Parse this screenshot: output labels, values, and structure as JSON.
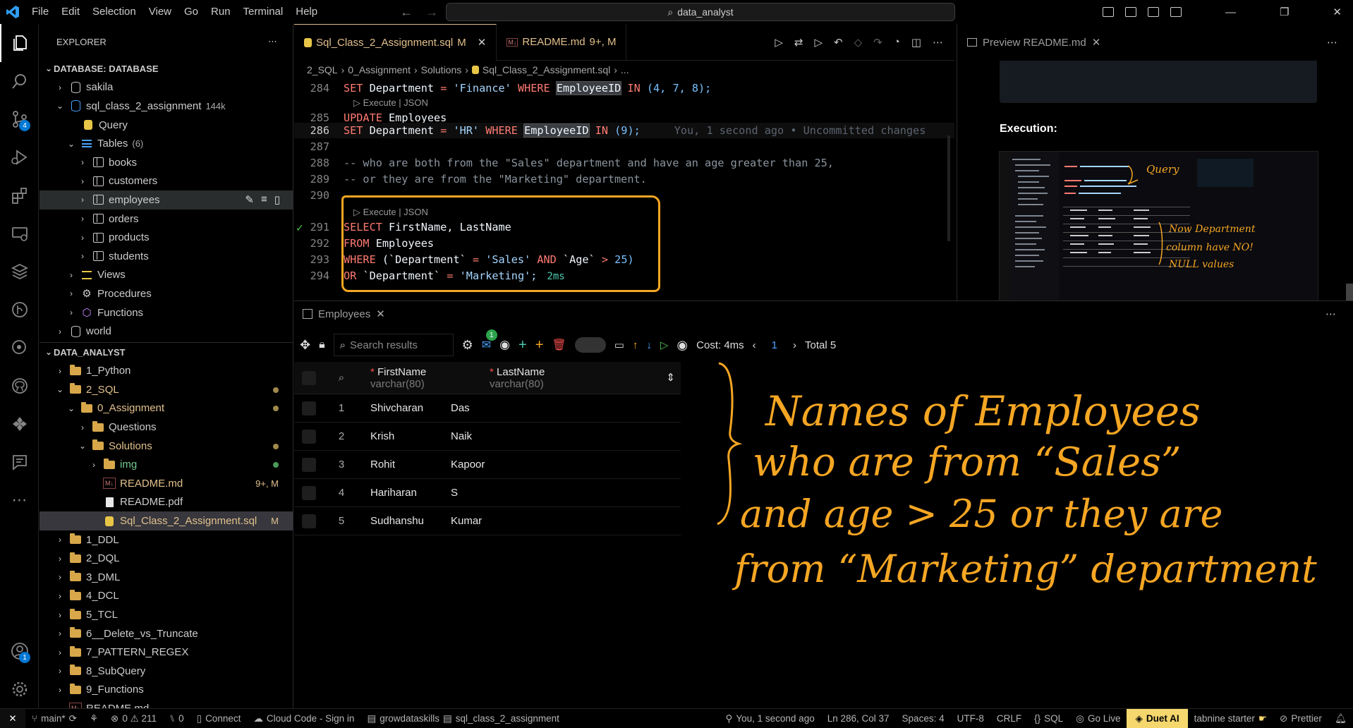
{
  "title": {
    "menus": [
      "File",
      "Edit",
      "Selection",
      "View",
      "Go",
      "Run",
      "Terminal",
      "Help"
    ],
    "search": "data_analyst"
  },
  "activity": {
    "scm_badge": "4",
    "account_badge": "1"
  },
  "explorer": {
    "header": "EXPLORER",
    "database_section": "DATABASE: DATABASE",
    "db_items": [
      {
        "label": "sakila"
      },
      {
        "label": "sql_class_2_assignment",
        "suffix": "144k"
      },
      {
        "label": "Query"
      },
      {
        "label": "Tables",
        "suffix": "(6)"
      },
      {
        "label": "books"
      },
      {
        "label": "customers"
      },
      {
        "label": "employees"
      },
      {
        "label": "orders"
      },
      {
        "label": "products"
      },
      {
        "label": "students"
      },
      {
        "label": "Views"
      },
      {
        "label": "Procedures"
      },
      {
        "label": "Functions"
      },
      {
        "label": "world"
      }
    ],
    "project_section": "DATA_ANALYST",
    "files": [
      {
        "label": "1_Python"
      },
      {
        "label": "2_SQL"
      },
      {
        "label": "0_Assignment"
      },
      {
        "label": "Questions"
      },
      {
        "label": "Solutions"
      },
      {
        "label": "img"
      },
      {
        "label": "README.md",
        "status": "9+, M"
      },
      {
        "label": "README.pdf"
      },
      {
        "label": "Sql_Class_2_Assignment.sql",
        "status": "M"
      },
      {
        "label": "1_DDL"
      },
      {
        "label": "2_DQL"
      },
      {
        "label": "3_DML"
      },
      {
        "label": "4_DCL"
      },
      {
        "label": "5_TCL"
      },
      {
        "label": "6__Delete_vs_Truncate"
      },
      {
        "label": "7_PATTERN_REGEX"
      },
      {
        "label": "8_SubQuery"
      },
      {
        "label": "9_Functions"
      },
      {
        "label": "README.md"
      }
    ]
  },
  "editor": {
    "tabs": [
      {
        "label": "Sql_Class_2_Assignment.sql",
        "status": "M"
      },
      {
        "label": "README.md",
        "status": "9+, M"
      }
    ],
    "breadcrumb": [
      "2_SQL",
      "0_Assignment",
      "Solutions",
      "Sql_Class_2_Assignment.sql",
      "..."
    ],
    "codelens": "Execute | JSON",
    "line_numbers": [
      "284",
      "285",
      "286",
      "287",
      "288",
      "289",
      "290",
      "291",
      "292",
      "293",
      "294"
    ],
    "l284": {
      "a": "SET",
      "b": "Department",
      "c": "=",
      "d": "'Finance'",
      "e": "WHERE",
      "f": "EmployeeID",
      "g": "IN",
      "h": "(4, 7, 8);"
    },
    "l285": {
      "a": "UPDATE",
      "b": "Employees"
    },
    "l286": {
      "a": "SET",
      "b": "Department",
      "c": "=",
      "d": "'HR'",
      "e": "WHERE",
      "f": "EmployeeID",
      "g": "IN",
      "h": "(9);",
      "blame": "You, 1 second ago • Uncommitted changes"
    },
    "l288": "-- who are both from the \"Sales\" department and have an age greater than 25,",
    "l289": "-- or they are from the \"Marketing\" department.",
    "l291": {
      "a": "SELECT",
      "b": "FirstName, LastName"
    },
    "l292": {
      "a": "FROM",
      "b": "Employees"
    },
    "l293": {
      "a": "WHERE",
      "b": "(`Department`",
      "c": "=",
      "d": "'Sales'",
      "e": "AND",
      "f": "`Age`",
      "g": ">",
      "h": "25)"
    },
    "l294": {
      "a": "OR",
      "b": "`Department`",
      "c": "=",
      "d": "'Marketing';",
      "time": "2ms"
    }
  },
  "preview": {
    "tab": "Preview README.md",
    "execution_label": "Execution:",
    "hand_query": "Query",
    "hand_note": [
      "Now Department",
      "column have NO!",
      "NULL values"
    ]
  },
  "panel": {
    "tab": "Employees",
    "search_placeholder": "Search results",
    "mail_badge": "1",
    "cost": "Cost: 4ms",
    "page": "1",
    "total": "Total 5",
    "columns": [
      {
        "name": "FirstName",
        "type": "varchar(80)"
      },
      {
        "name": "LastName",
        "type": "varchar(80)"
      }
    ],
    "rows": [
      {
        "n": "1",
        "first": "Shivcharan",
        "last": "Das"
      },
      {
        "n": "2",
        "first": "Krish",
        "last": "Naik"
      },
      {
        "n": "3",
        "first": "Rohit",
        "last": "Kapoor"
      },
      {
        "n": "4",
        "first": "Hariharan",
        "last": "S"
      },
      {
        "n": "5",
        "first": "Sudhanshu",
        "last": "Kumar"
      }
    ],
    "handwriting": [
      "Names of Employees",
      "who are from “Sales”",
      "and age > 25 or they are",
      "from “Marketing” department"
    ]
  },
  "status": {
    "branch": "main*",
    "problems": "0 ⚠ 211",
    "ports": "0",
    "connect": "Connect",
    "cloud": "Cloud Code - Sign in",
    "db": "growdataskills",
    "schema": "sql_class_2_assignment",
    "blame": "You, 1 second ago",
    "position": "Ln 286, Col 37",
    "spaces": "Spaces: 4",
    "encoding": "UTF-8",
    "eol": "CRLF",
    "lang": "SQL",
    "golive": "Go Live",
    "duet": "Duet AI",
    "tabnine": "tabnine starter",
    "prettier": "Prettier"
  },
  "colors": {
    "accent": "#f5a623",
    "modified": "#e2c08d",
    "keyword": "#ff7b72",
    "string": "#a5d6ff"
  }
}
